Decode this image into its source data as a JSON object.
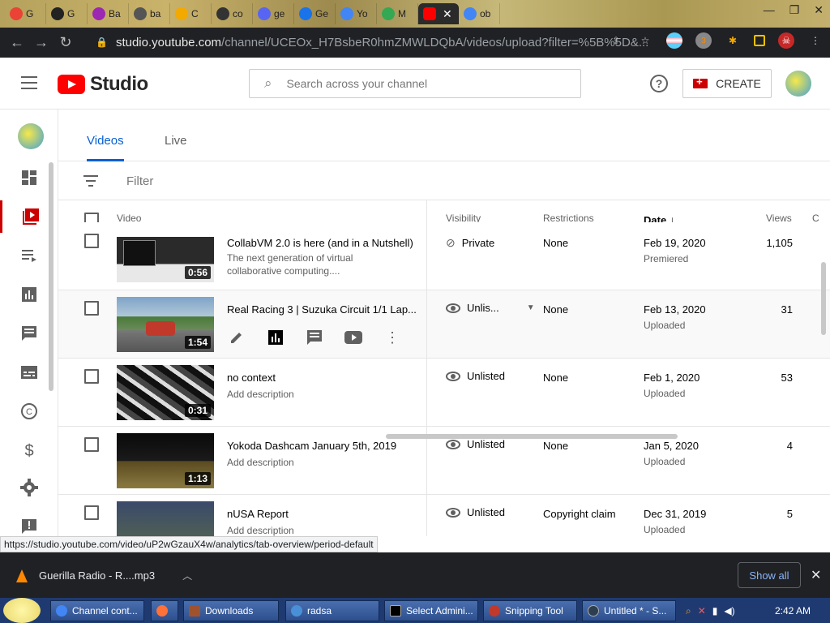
{
  "browser": {
    "tabs": [
      {
        "label": "G",
        "color": "#ea4335"
      },
      {
        "label": "G",
        "color": "#4285f4"
      },
      {
        "label": "Ba",
        "color": "#9c27b0"
      },
      {
        "label": "ba",
        "color": "#555555"
      },
      {
        "label": "C",
        "color": "#f2a900"
      },
      {
        "label": "co",
        "color": "#333333"
      },
      {
        "label": "ge",
        "color": "#5865f2"
      },
      {
        "label": "Ge",
        "color": "#1a73e8"
      },
      {
        "label": "Yo",
        "color": "#4285f4"
      },
      {
        "label": "M",
        "color": "#34a853"
      }
    ],
    "active_tab_color": "#ff0000",
    "after_tab": {
      "label": "ob",
      "color": "#4285f4"
    },
    "url": "studio.youtube.com",
    "url_path": "/channel/UCEOx_H7BsbeR0hmZMWLDQbA/videos/upload?filter=%5B%5D&...",
    "extension_badge": "3"
  },
  "header": {
    "logo_text": "Studio",
    "search_placeholder": "Search across your channel",
    "create_label": "CREATE"
  },
  "tabs": {
    "videos": "Videos",
    "live": "Live"
  },
  "filter": {
    "label": "Filter"
  },
  "columns": {
    "video": "Video",
    "visibility": "Visibility",
    "restrictions": "Restrictions",
    "date": "Date",
    "views": "Views",
    "comments": "C"
  },
  "rows": [
    {
      "title": "CollabVM 2.0 is here (and in a Nutshell)",
      "description": "The next generation of virtual collaborative computing....",
      "duration": "0:56",
      "visibility": "Private",
      "restrictions": "None",
      "date": "Feb 19, 2020",
      "date_sub": "Premiered",
      "views": "1,105"
    },
    {
      "title": "Real Racing 3 | Suzuka Circuit 1/1 Lap...",
      "description": "",
      "duration": "1:54",
      "visibility": "Unlis...",
      "restrictions": "None",
      "date": "Feb 13, 2020",
      "date_sub": "Uploaded",
      "views": "31"
    },
    {
      "title": "no context",
      "description": "Add description",
      "duration": "0:31",
      "visibility": "Unlisted",
      "restrictions": "None",
      "date": "Feb 1, 2020",
      "date_sub": "Uploaded",
      "views": "53"
    },
    {
      "title": "Yokoda Dashcam January 5th, 2019",
      "description": "Add description",
      "duration": "1:13",
      "visibility": "Unlisted",
      "restrictions": "None",
      "date": "Jan 5, 2020",
      "date_sub": "Uploaded",
      "views": "4"
    },
    {
      "title": "nUSA Report",
      "description": "Add description",
      "duration": "",
      "visibility": "Unlisted",
      "restrictions": "Copyright claim",
      "date": "Dec 31, 2019",
      "date_sub": "Uploaded",
      "views": "5"
    }
  ],
  "status_url": "https://studio.youtube.com/video/uP2wGzauX4w/analytics/tab-overview/period-default",
  "download": {
    "file": "Guerilla Radio - R....mp3",
    "show_all": "Show all"
  },
  "taskbar": {
    "items": [
      {
        "label": "Channel cont...",
        "color": "#4285f4"
      },
      {
        "label": "",
        "color": "#ff7139"
      },
      {
        "label": "Downloads",
        "color": "#a0522d"
      },
      {
        "label": "radsa",
        "color": "#4a90d9"
      },
      {
        "label": "Select Admini...",
        "color": "#000000"
      },
      {
        "label": "Snipping Tool",
        "color": "#c0392b"
      },
      {
        "label": "Untitled * - S...",
        "color": "#2c3e50"
      }
    ],
    "clock": "2:42 AM"
  }
}
